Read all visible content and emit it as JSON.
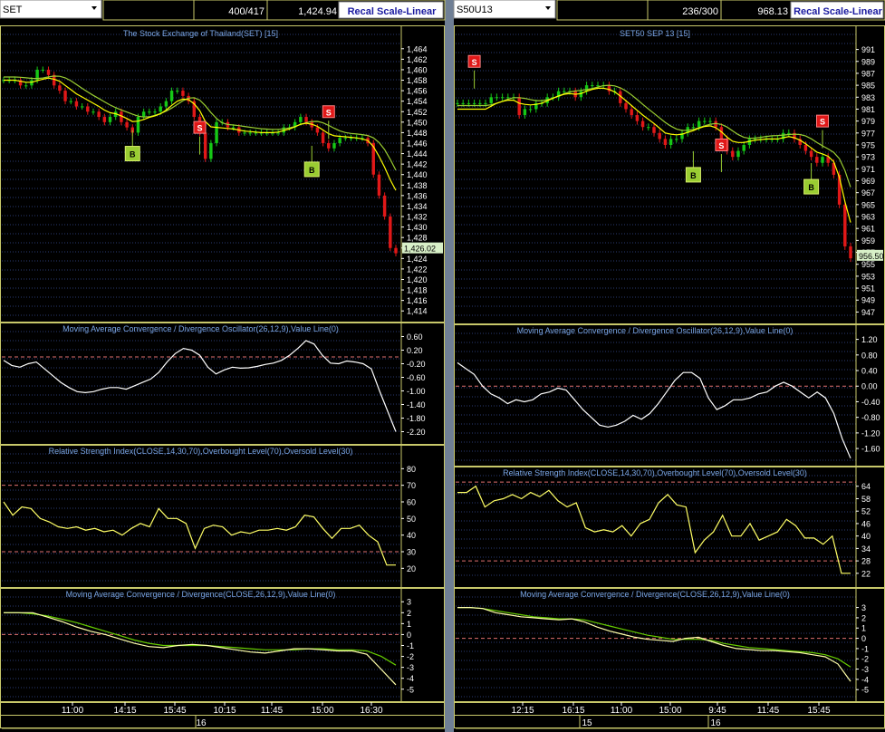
{
  "colors": {
    "bg": "#000000",
    "grid": "#2a3a72",
    "header_border": "#c8c86a",
    "price_axis": "#ffffff",
    "ma_fast": "#ffff00",
    "ma_slow": "#9acd32",
    "candle_up": "#16c816",
    "candle_down": "#e01818",
    "osc_line": "#ffffff",
    "rsi_line": "#ffff66",
    "macd_line": "#ffffaa",
    "signal_line": "#66cc00",
    "ref_line": "#e07070",
    "title": "#7aa6e6",
    "recal_text": "#1a1aa0",
    "buy_box": "#9acd32",
    "sell_box": "#e01818"
  },
  "panels": [
    {
      "id": "left",
      "symbol": "SET",
      "counter": "400/417",
      "last_price": "1,424.94",
      "recal_label": "Recal Scale-Linear",
      "price_title": "The Stock Exchange of Thailand(SET) [15]",
      "price_label": "1,426.02",
      "osc_title": "Moving Average Convergence / Divergence Oscillator(26,12,9),Value Line(0)",
      "rsi_title": "Relative Strength Index(CLOSE,14,30,70),Overbought Level(70),Oversold Level(30)",
      "macd_title": "Moving Average Convergence / Divergence(CLOSE,26,12,9),Value Line(0)",
      "time_ticks": [
        "11:00",
        "14:15",
        "15:45",
        "10:15",
        "11:45",
        "15:00",
        "16:30"
      ],
      "date_tick": "16",
      "b_label": "B",
      "s_label": "S"
    },
    {
      "id": "right",
      "symbol": "S50U13",
      "counter": "236/300",
      "last_price": "968.13",
      "recal_label": "Recal Scale-Linear",
      "price_title": "SET50 SEP 13   [15]",
      "price_label": "956.50",
      "osc_title": "Moving Average Convergence / Divergence Oscillator(26,12,9),Value Line(0)",
      "rsi_title": "Relative Strength Index(CLOSE,14,30,70),Overbought Level(70),Oversold Level(30)",
      "macd_title": "Moving Average Convergence / Divergence(CLOSE,26,12,9),Value Line(0)",
      "time_ticks": [
        "12:15",
        "16:15",
        "11:00",
        "15:00",
        "9:45",
        "11:45",
        "15:45"
      ],
      "date_ticks": [
        "15",
        "16"
      ],
      "b_label": "B",
      "s_label": "S"
    }
  ],
  "chart_data": [
    {
      "type": "candlestick",
      "title": "The Stock Exchange of Thailand(SET) [15]",
      "y_ticks": [
        "1,464",
        "1,462",
        "1,460",
        "1,458",
        "1,456",
        "1,454",
        "1,452",
        "1,450",
        "1,448",
        "1,446",
        "1,444",
        "1,442",
        "1,440",
        "1,438",
        "1,436",
        "1,434",
        "1,432",
        "1,430",
        "1,428",
        "1,426",
        "1,424",
        "1,422",
        "1,420",
        "1,418",
        "1,416",
        "1,414"
      ],
      "ylim": [
        1413,
        1465
      ],
      "close": [
        1458,
        1458,
        1458,
        1457,
        1457,
        1458,
        1460,
        1460,
        1459,
        1457,
        1456,
        1454,
        1454,
        1453,
        1453,
        1452,
        1452,
        1451,
        1450,
        1451,
        1452,
        1450,
        1449,
        1448,
        1451,
        1452,
        1452,
        1452,
        1453,
        1454,
        1456,
        1456,
        1455,
        1454,
        1451,
        1448,
        1443,
        1446,
        1450,
        1450,
        1449,
        1449,
        1448,
        1448,
        1448,
        1448,
        1448,
        1448,
        1448,
        1448,
        1449,
        1449,
        1450,
        1451,
        1450,
        1449,
        1448,
        1446,
        1445,
        1446,
        1447,
        1447,
        1447,
        1447,
        1447,
        1446,
        1440,
        1436,
        1432,
        1426,
        1425
      ],
      "ma_fast": [
        1458,
        1458,
        1458,
        1457.8,
        1457.6,
        1457.6,
        1457.9,
        1458.2,
        1458.4,
        1458.2,
        1457.8,
        1457,
        1456.2,
        1455.4,
        1454.8,
        1454.2,
        1453.6,
        1453,
        1452.3,
        1451.8,
        1451.6,
        1451.2,
        1450.7,
        1450.1,
        1450.2,
        1450.5,
        1450.9,
        1451.2,
        1451.6,
        1452.3,
        1453.2,
        1454,
        1454.4,
        1454.3,
        1453.5,
        1452.2,
        1450.1,
        1449.1,
        1449,
        1448.9,
        1448.8,
        1448.7,
        1448.5,
        1448.3,
        1448.2,
        1448.1,
        1448,
        1448,
        1448,
        1448.1,
        1448.4,
        1448.7,
        1449.1,
        1449.6,
        1449.8,
        1449.6,
        1449.2,
        1448.5,
        1447.8,
        1447.4,
        1447.3,
        1447.2,
        1447.1,
        1447,
        1446.8,
        1446.5,
        1445.3,
        1443.5,
        1441.4,
        1439,
        1437
      ]
    },
    {
      "type": "line",
      "title": "Moving Average Convergence / Divergence Oscillator(26,12,9),Value Line(0)",
      "y_ticks": [
        "0.60",
        "0.20",
        "-0.20",
        "-0.60",
        "-1.00",
        "-1.40",
        "-1.80",
        "-2.20"
      ],
      "ylim": [
        -2.4,
        0.8
      ],
      "ref": 0,
      "values": [
        -0.1,
        -0.25,
        -0.3,
        -0.2,
        -0.15,
        -0.35,
        -0.55,
        -0.75,
        -0.9,
        -1.02,
        -1.05,
        -1.02,
        -0.95,
        -0.9,
        -0.9,
        -0.95,
        -0.85,
        -0.75,
        -0.65,
        -0.45,
        -0.15,
        0.1,
        0.25,
        0.2,
        0.05,
        -0.3,
        -0.5,
        -0.38,
        -0.3,
        -0.33,
        -0.32,
        -0.28,
        -0.22,
        -0.18,
        -0.1,
        0.05,
        0.25,
        0.48,
        0.38,
        0.05,
        -0.18,
        -0.2,
        -0.12,
        -0.15,
        -0.2,
        -0.35,
        -1.0,
        -1.6,
        -2.2
      ]
    },
    {
      "type": "line",
      "title": "Relative Strength Index(CLOSE,14,30,70),Overbought Level(70),Oversold Level(30)",
      "y_ticks": [
        "80",
        "70",
        "60",
        "50",
        "40",
        "30",
        "20"
      ],
      "ylim": [
        12,
        90
      ],
      "overbought": 70,
      "oversold": 30,
      "values": [
        60,
        52,
        57,
        56,
        50,
        48,
        45,
        44,
        45,
        43,
        44,
        42,
        43,
        40,
        44,
        47,
        45,
        56,
        50,
        50,
        47,
        32,
        44,
        46,
        45,
        40,
        42,
        41,
        43,
        43,
        44,
        43,
        45,
        52,
        51,
        44,
        38,
        44,
        44,
        46,
        40,
        36,
        22,
        22
      ]
    },
    {
      "type": "line",
      "title": "Moving Average Convergence / Divergence(CLOSE,26,12,9),Value Line(0)",
      "y_ticks": [
        "3",
        "2",
        "1",
        "0",
        "-1",
        "-2",
        "-3",
        "-4",
        "-5"
      ],
      "ylim": [
        -5.6,
        3.6
      ],
      "ref": 0,
      "series": [
        {
          "values": [
            2.0,
            2.0,
            2.0,
            1.6,
            1.2,
            0.7,
            0.3,
            0.0,
            -0.4,
            -0.8,
            -1.1,
            -1.2,
            -1.0,
            -0.9,
            -1.0,
            -1.2,
            -1.4,
            -1.6,
            -1.7,
            -1.5,
            -1.3,
            -1.3,
            -1.4,
            -1.5,
            -1.5,
            -1.8,
            -3.2,
            -4.6
          ]
        },
        {
          "values": [
            2.0,
            2.0,
            1.9,
            1.7,
            1.4,
            1.1,
            0.7,
            0.3,
            -0.1,
            -0.5,
            -0.8,
            -1.0,
            -1.0,
            -1.0,
            -1.0,
            -1.1,
            -1.2,
            -1.3,
            -1.4,
            -1.4,
            -1.4,
            -1.3,
            -1.3,
            -1.4,
            -1.4,
            -1.5,
            -2.0,
            -2.8
          ]
        }
      ]
    },
    {
      "type": "candlestick",
      "title": "SET50 SEP 13   [15]",
      "y_ticks": [
        "991",
        "989",
        "987",
        "985",
        "983",
        "981",
        "979",
        "977",
        "975",
        "973",
        "971",
        "969",
        "967",
        "965",
        "963",
        "961",
        "959",
        "957",
        "955",
        "953",
        "951",
        "949",
        "947"
      ],
      "ylim": [
        946,
        992
      ],
      "close": [
        982,
        982,
        982,
        982,
        982,
        982,
        983,
        983,
        983,
        983,
        983,
        980,
        981,
        981,
        982,
        982,
        983,
        983,
        984,
        984,
        984,
        983,
        984,
        985,
        985,
        985,
        985,
        984,
        984,
        982,
        981,
        980,
        979,
        978,
        978,
        977,
        976,
        975,
        976,
        976,
        977,
        978,
        978,
        979,
        979,
        979,
        978,
        976,
        974,
        973,
        974,
        975,
        976,
        976,
        976,
        976,
        976,
        976,
        977,
        977,
        976,
        975,
        974,
        973,
        972,
        973,
        972,
        970,
        965,
        958,
        956
      ],
      "ma_fast": [
        981,
        981,
        981,
        981,
        981,
        981,
        981.5,
        982,
        982.3,
        982.5,
        982.5,
        982,
        981.8,
        981.7,
        981.8,
        982,
        982.4,
        982.8,
        983.2,
        983.5,
        983.6,
        983.5,
        983.6,
        984,
        984.3,
        984.5,
        984.5,
        984.3,
        983.9,
        983.2,
        982.4,
        981.6,
        980.8,
        980,
        979.3,
        978.6,
        977.8,
        977,
        976.8,
        976.7,
        976.8,
        977.1,
        977.4,
        977.8,
        978.1,
        978.2,
        977.9,
        977.2,
        976.3,
        975.6,
        975.4,
        975.4,
        975.6,
        975.8,
        975.9,
        976,
        976,
        976,
        976.2,
        976.4,
        976.2,
        975.8,
        975.2,
        974.5,
        973.8,
        973.5,
        973.1,
        972.2,
        969.6,
        965.5,
        962
      ]
    },
    {
      "type": "line",
      "title": "Moving Average Convergence / Divergence Oscillator(26,12,9),Value Line(0)",
      "y_ticks": [
        "1.20",
        "0.80",
        "0.40",
        "0.00",
        "-0.40",
        "-0.80",
        "-1.20",
        "-1.60"
      ],
      "ylim": [
        -1.9,
        1.4
      ],
      "ref": 0,
      "values": [
        0.6,
        0.45,
        0.3,
        0.0,
        -0.2,
        -0.3,
        -0.45,
        -0.35,
        -0.4,
        -0.35,
        -0.2,
        -0.15,
        -0.05,
        -0.1,
        -0.35,
        -0.6,
        -0.8,
        -1.0,
        -1.05,
        -1.0,
        -0.9,
        -0.75,
        -0.85,
        -0.7,
        -0.45,
        -0.15,
        0.15,
        0.35,
        0.35,
        0.2,
        -0.3,
        -0.6,
        -0.5,
        -0.35,
        -0.35,
        -0.3,
        -0.2,
        -0.15,
        0.0,
        0.1,
        0.0,
        -0.15,
        -0.3,
        -0.15,
        -0.3,
        -0.7,
        -1.35,
        -1.85
      ]
    },
    {
      "type": "line",
      "title": "Relative Strength Index(CLOSE,14,30,70),Overbought Level(70),Oversold Level(30)",
      "y_ticks": [
        "64",
        "58",
        "52",
        "46",
        "40",
        "34",
        "28",
        "22"
      ],
      "ylim": [
        18,
        70
      ],
      "overbought": 66,
      "oversold": 28,
      "values": [
        61,
        61,
        64,
        54,
        57,
        58,
        60,
        58,
        61,
        59,
        62,
        57,
        54,
        56,
        44,
        42,
        43,
        42,
        45,
        40,
        46,
        48,
        56,
        60,
        55,
        54,
        32,
        38,
        42,
        50,
        40,
        40,
        46,
        38,
        40,
        42,
        48,
        45,
        39,
        39,
        36,
        40,
        22,
        22
      ]
    },
    {
      "type": "line",
      "title": "Moving Average Convergence / Divergence(CLOSE,26,12,9),Value Line(0)",
      "y_ticks": [
        "3",
        "2",
        "1",
        "0",
        "-1",
        "-2",
        "-3",
        "-4",
        "-5"
      ],
      "ylim": [
        -5.6,
        4.2
      ],
      "ref": 0,
      "series": [
        {
          "values": [
            3.0,
            3.0,
            2.9,
            2.5,
            2.3,
            2.1,
            2.0,
            1.9,
            1.8,
            1.9,
            1.6,
            1.1,
            0.7,
            0.4,
            0.1,
            -0.1,
            -0.2,
            -0.3,
            0.0,
            0.1,
            -0.3,
            -0.7,
            -1.0,
            -1.1,
            -1.2,
            -1.2,
            -1.3,
            -1.4,
            -1.6,
            -1.8,
            -2.5,
            -4.2
          ]
        },
        {
          "values": [
            3.0,
            3.0,
            2.9,
            2.7,
            2.5,
            2.3,
            2.1,
            2.0,
            1.9,
            1.9,
            1.8,
            1.5,
            1.2,
            0.9,
            0.6,
            0.3,
            0.1,
            -0.1,
            -0.1,
            -0.1,
            -0.2,
            -0.5,
            -0.7,
            -0.9,
            -1.0,
            -1.1,
            -1.2,
            -1.3,
            -1.4,
            -1.6,
            -2.0,
            -2.8
          ]
        }
      ]
    }
  ],
  "markers": [
    {
      "panel": "left",
      "type": "B",
      "x_index": 23,
      "value": 1444
    },
    {
      "panel": "left",
      "type": "S",
      "x_index": 35,
      "value": 1449
    },
    {
      "panel": "left",
      "type": "B",
      "x_index": 55,
      "value": 1441
    },
    {
      "panel": "left",
      "type": "S",
      "x_index": 58,
      "value": 1452
    },
    {
      "panel": "right",
      "type": "S",
      "x_index": 3,
      "value": 989
    },
    {
      "panel": "right",
      "type": "B",
      "x_index": 42,
      "value": 970
    },
    {
      "panel": "right",
      "type": "S",
      "x_index": 47,
      "value": 975
    },
    {
      "panel": "right",
      "type": "B",
      "x_index": 63,
      "value": 968
    },
    {
      "panel": "right",
      "type": "S",
      "x_index": 65,
      "value": 979
    }
  ]
}
